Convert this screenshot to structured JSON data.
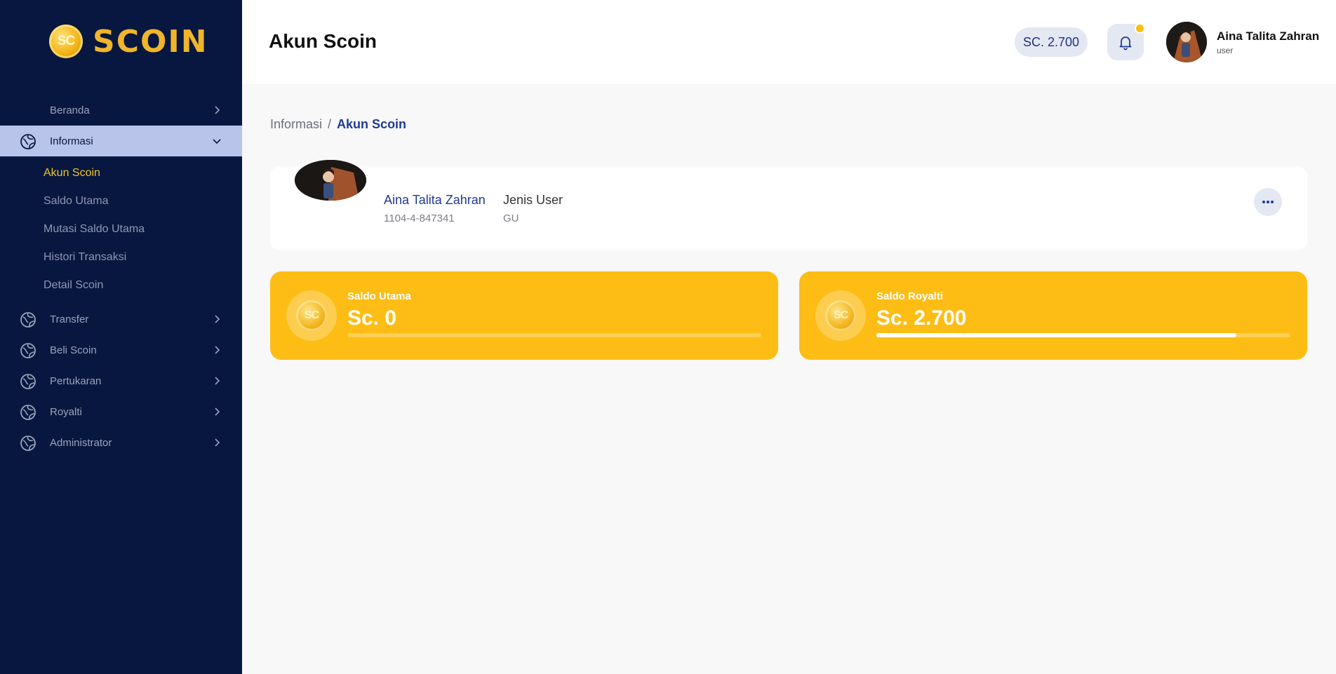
{
  "brand": {
    "logo_text": "SCOIN",
    "coin_letters": "SC",
    "accent": "#fdbd14",
    "sidebar_bg": "#07173f"
  },
  "sidebar": {
    "items": [
      {
        "label": "Beranda",
        "icon": "none",
        "expanded": false
      },
      {
        "label": "Informasi",
        "icon": "globe-icon",
        "expanded": true,
        "subitems": [
          "Akun Scoin",
          "Saldo Utama",
          "Mutasi Saldo Utama",
          "Histori Transaksi",
          "Detail Scoin"
        ],
        "current_subitem": "Akun Scoin"
      },
      {
        "label": "Transfer",
        "icon": "globe-icon",
        "expanded": false
      },
      {
        "label": "Beli Scoin",
        "icon": "globe-icon",
        "expanded": false
      },
      {
        "label": "Pertukaran",
        "icon": "globe-icon",
        "expanded": false
      },
      {
        "label": "Royalti",
        "icon": "globe-icon",
        "expanded": false
      },
      {
        "label": "Administrator",
        "icon": "globe-icon",
        "expanded": false
      }
    ]
  },
  "header": {
    "title": "Akun Scoin",
    "balance": "SC. 2.700",
    "notification_icon": "bell-icon",
    "user": {
      "name": "Aina Talita Zahran",
      "role": "user"
    }
  },
  "breadcrumb": {
    "parent": "Informasi",
    "separator": "/",
    "current": "Akun Scoin"
  },
  "profile": {
    "name": "Aina Talita Zahran",
    "account_number": "1104-4-847341",
    "type_label": "Jenis User",
    "type_value": "GU",
    "more_icon": "more-horizontal-icon"
  },
  "balances": [
    {
      "label": "Saldo Utama",
      "amount": "Sc. 0",
      "progress": 0.0
    },
    {
      "label": "Saldo Royalti",
      "amount": "Sc. 2.700",
      "progress": 0.87
    }
  ]
}
